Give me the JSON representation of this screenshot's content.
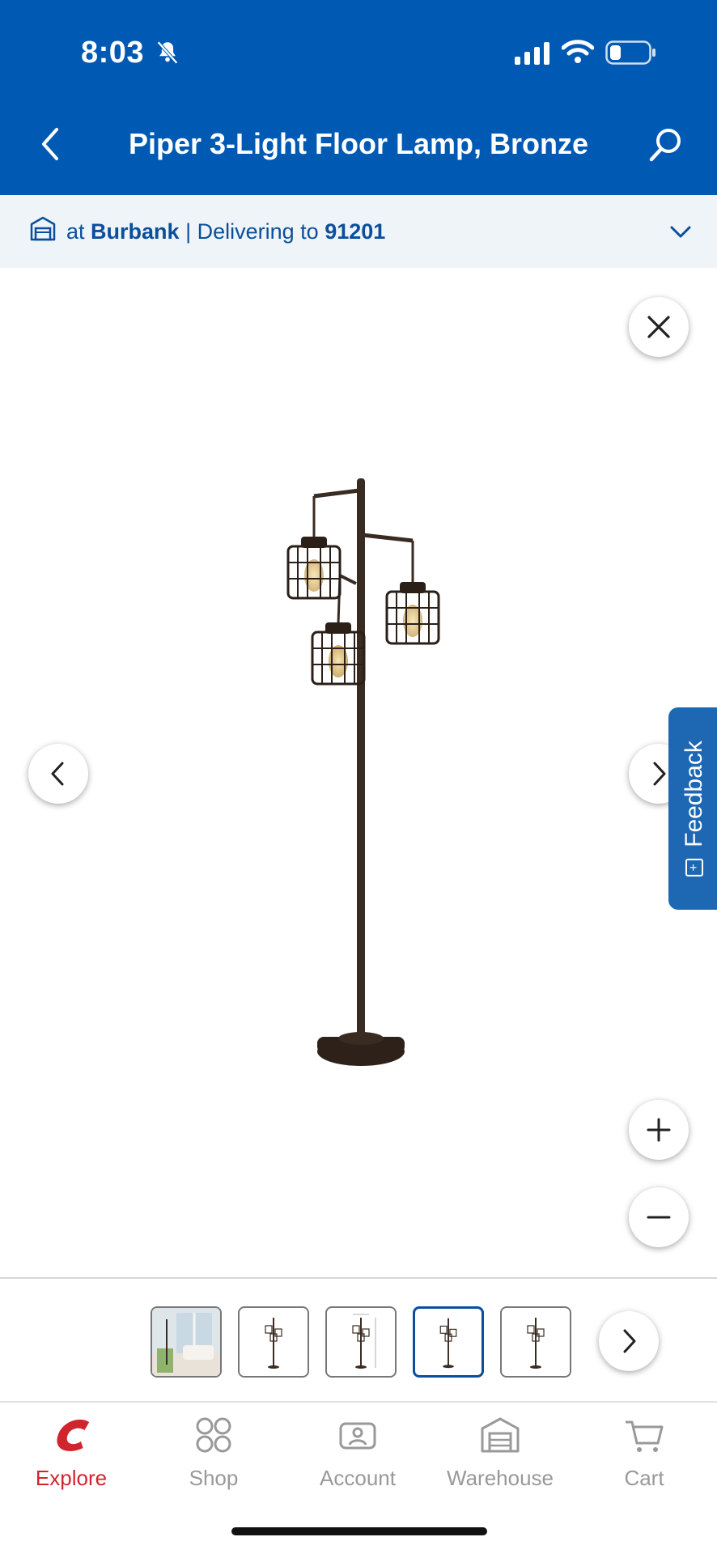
{
  "status_bar": {
    "time": "8:03",
    "colors": {
      "header": "#0059b3"
    }
  },
  "header": {
    "title": "Piper 3-Light Floor Lamp, Bronze",
    "back_icon": "chevron-left-icon",
    "search_icon": "search-icon"
  },
  "location": {
    "prefix": "at",
    "store": "Burbank",
    "separator": "|",
    "delivering_label": "Delivering to",
    "zip": "91201"
  },
  "viewer": {
    "buttons": [
      "close-icon",
      "chevron-left-icon",
      "chevron-right-icon",
      "plus-icon",
      "minus-icon"
    ],
    "feedback_label": "Feedback"
  },
  "thumbnails": {
    "count": 5,
    "selected_index": 3
  },
  "tabbar": {
    "items": [
      {
        "label": "Explore",
        "icon": "costco-logo-icon",
        "active": true
      },
      {
        "label": "Shop",
        "icon": "grid-icon",
        "active": false
      },
      {
        "label": "Account",
        "icon": "account-icon",
        "active": false
      },
      {
        "label": "Warehouse",
        "icon": "warehouse-icon",
        "active": false
      },
      {
        "label": "Cart",
        "icon": "cart-icon",
        "active": false
      }
    ],
    "colors": {
      "active": "#d1252e",
      "inactive": "#999999"
    }
  }
}
